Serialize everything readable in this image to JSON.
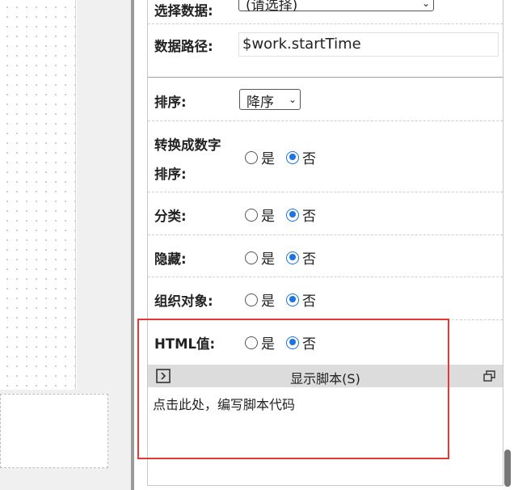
{
  "fields": {
    "select_data_label": "选择数据:",
    "select_data_value": "(请选择)",
    "data_path_label": "数据路径:",
    "data_path_value": "$work.startTime",
    "sort_label": "排序:",
    "sort_value": "降序",
    "convert_sort_label_line1": "转换成数字",
    "convert_sort_label_line2": "排序:",
    "category_label": "分类:",
    "hidden_label": "隐藏:",
    "group_object_label": "组织对象:",
    "html_value_label": "HTML值:"
  },
  "radio": {
    "yes": "是",
    "no": "否",
    "convert_sort": "否",
    "category": "否",
    "hidden": "否",
    "group_object": "否",
    "html_value": "否"
  },
  "script": {
    "title": "显示脚本(S)",
    "placeholder": "点击此处，编写脚本代码"
  },
  "colors": {
    "radio_checked": "#1a73e8",
    "highlight_border": "#e53935",
    "script_bar_bg": "#dcdcdc"
  }
}
